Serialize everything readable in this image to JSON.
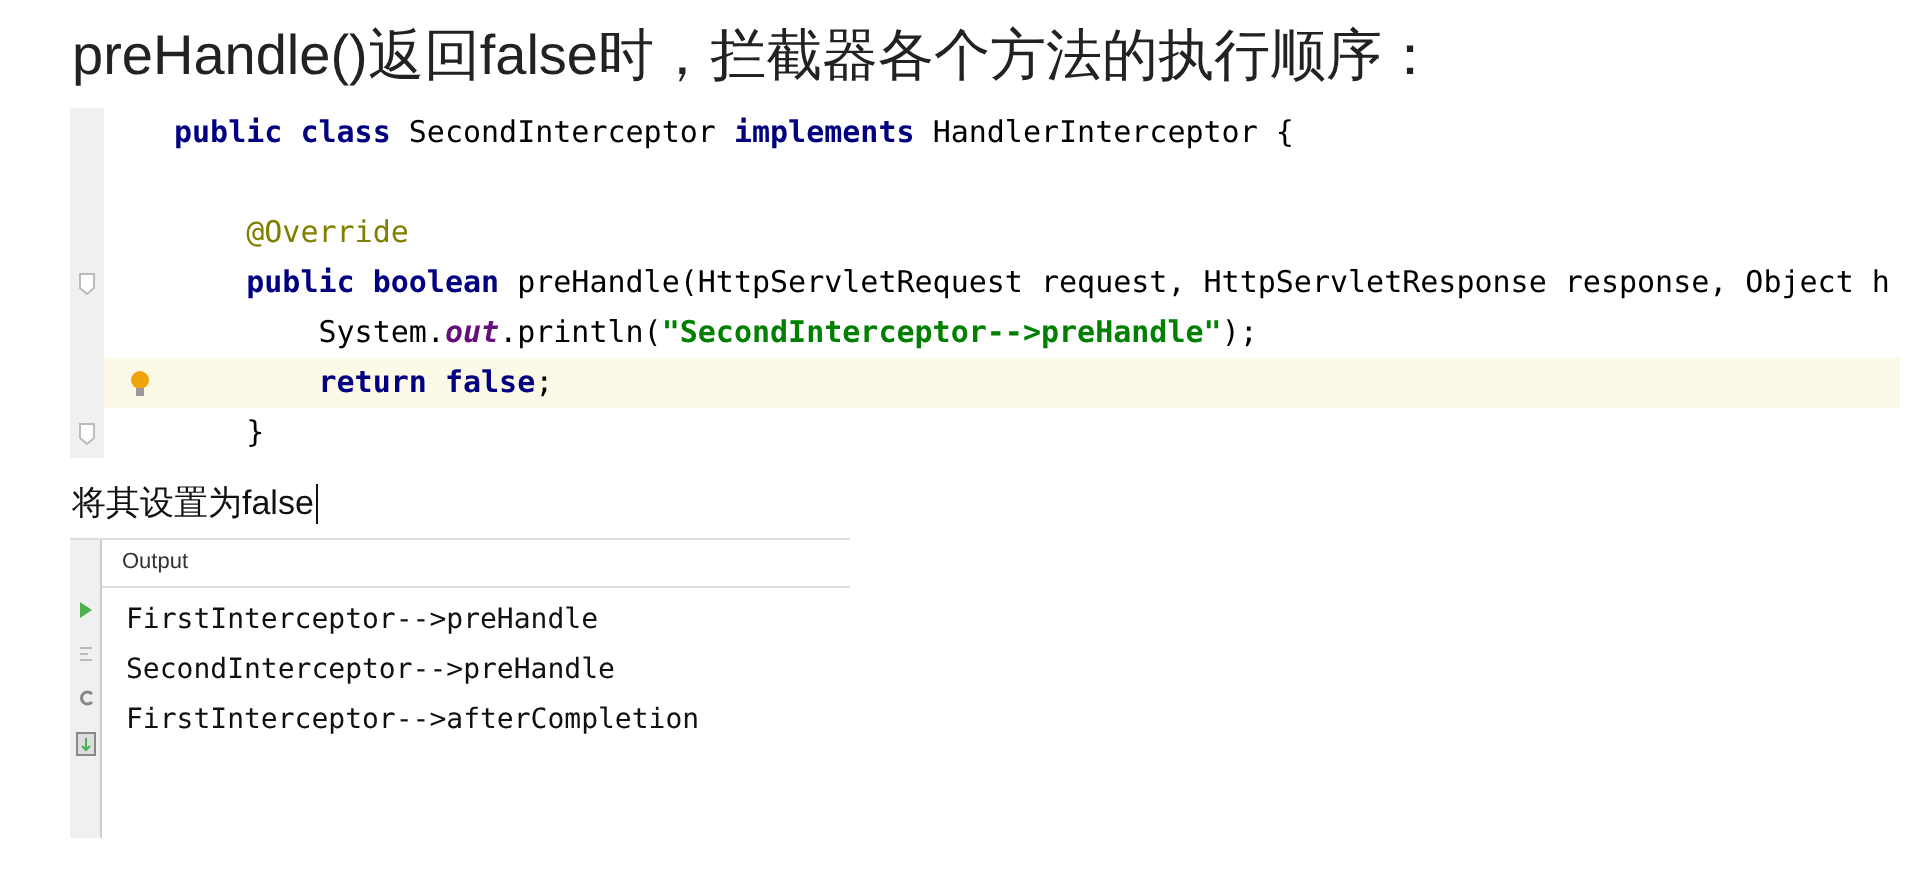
{
  "heading": "preHandle()返回false时，拦截器各个方法的执行顺序：",
  "code": {
    "lines": [
      {
        "highlighted": false,
        "fold": false,
        "bulb": false,
        "tokens": [
          {
            "kind": "keyword",
            "text": "public class "
          },
          {
            "kind": "plain",
            "text": "SecondInterceptor "
          },
          {
            "kind": "keyword",
            "text": "implements "
          },
          {
            "kind": "plain",
            "text": "HandlerInterceptor {"
          }
        ]
      },
      {
        "highlighted": false,
        "fold": false,
        "bulb": false
      },
      {
        "highlighted": false,
        "fold": false,
        "bulb": false,
        "tokens": [
          {
            "kind": "annotation",
            "text": "    @Override"
          }
        ]
      },
      {
        "highlighted": false,
        "fold": true,
        "bulb": false,
        "tokens": [
          {
            "kind": "keyword",
            "text": "    public boolean "
          },
          {
            "kind": "plain",
            "text": "preHandle(HttpServletRequest request, HttpServletResponse response, Object h"
          }
        ]
      },
      {
        "highlighted": false,
        "fold": false,
        "bulb": false,
        "tokens": [
          {
            "kind": "plain",
            "text": "        System."
          },
          {
            "kind": "italic",
            "text": "out"
          },
          {
            "kind": "plain",
            "text": ".println("
          },
          {
            "kind": "string",
            "text": "\"SecondInterceptor-->preHandle\""
          },
          {
            "kind": "plain",
            "text": ");"
          }
        ]
      },
      {
        "highlighted": true,
        "fold": false,
        "bulb": true,
        "tokens": [
          {
            "kind": "keyword",
            "text": "        return false"
          },
          {
            "kind": "plain",
            "text": ";"
          }
        ]
      },
      {
        "highlighted": false,
        "fold": true,
        "bulb": false,
        "tokens": [
          {
            "kind": "plain",
            "text": "    }"
          }
        ]
      }
    ]
  },
  "caption": "将其设置为false",
  "output": {
    "title": "Output",
    "lines": [
      "FirstInterceptor-->preHandle",
      "SecondInterceptor-->preHandle",
      "FirstInterceptor-->afterCompletion"
    ]
  }
}
